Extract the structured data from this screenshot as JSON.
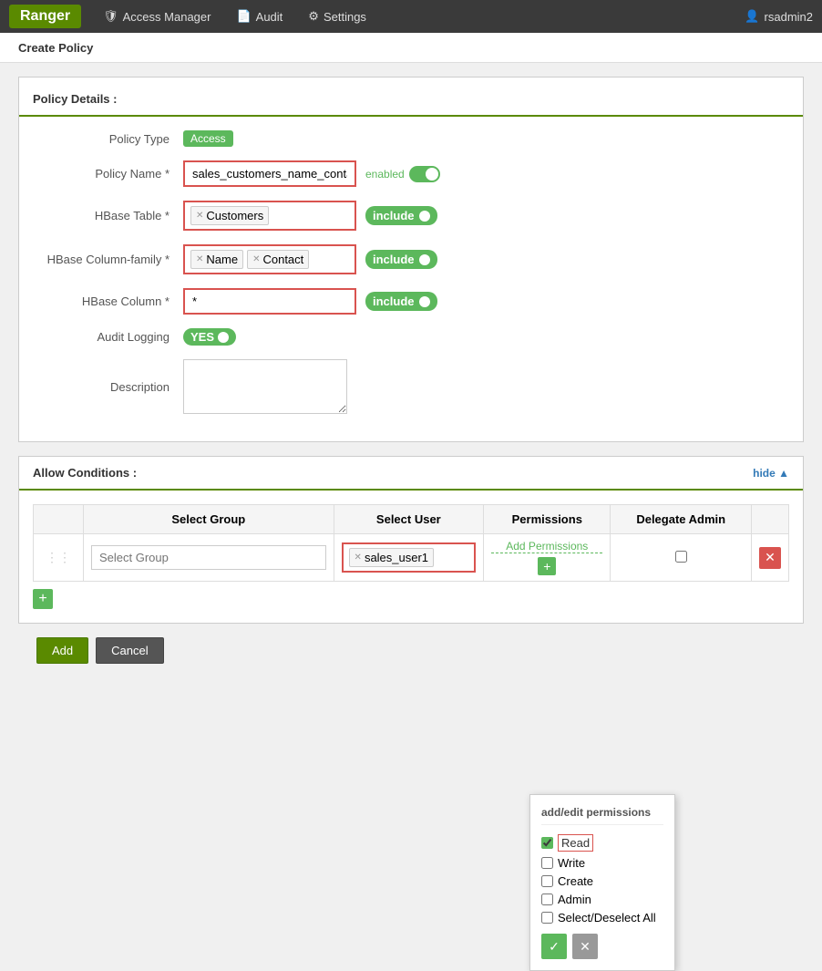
{
  "nav": {
    "brand": "Ranger",
    "items": [
      {
        "id": "access-manager",
        "label": "Access Manager",
        "icon": "🛡"
      },
      {
        "id": "audit",
        "label": "Audit",
        "icon": "📄"
      },
      {
        "id": "settings",
        "label": "Settings",
        "icon": "⚙"
      }
    ],
    "user": "rsadmin2",
    "user_icon": "👤"
  },
  "page": {
    "title": "Create Policy"
  },
  "policy_details": {
    "section_title": "Policy Details :",
    "policy_type_label": "Policy Type",
    "policy_type_badge": "Access",
    "policy_name_label": "Policy Name *",
    "policy_name_value": "sales_customers_name_contact",
    "policy_name_enabled": "enabled",
    "hbase_table_label": "HBase Table *",
    "hbase_table_tag": "Customers",
    "hbase_table_include": "include",
    "hbase_column_family_label": "HBase Column-family *",
    "hbase_column_tag1": "Name",
    "hbase_column_tag2": "Contact",
    "hbase_column_include": "include",
    "hbase_column_label": "HBase Column *",
    "hbase_column_value": "*",
    "hbase_column_include2": "include",
    "audit_logging_label": "Audit Logging",
    "audit_yes": "YES",
    "description_label": "Description"
  },
  "allow_conditions": {
    "section_title": "Allow Conditions :",
    "hide_label": "hide ▲",
    "table_headers": {
      "select_group": "Select Group",
      "select_user": "Select User",
      "permissions": "Permissions",
      "delegate_admin": "Delegate Admin"
    },
    "row": {
      "group_placeholder": "Select Group",
      "user_tag": "sales_user1",
      "add_perms_label": "Add Permissions",
      "add_perms_btn": "+"
    }
  },
  "permissions_popup": {
    "title": "add/edit permissions",
    "checkboxes": [
      {
        "id": "read",
        "label": "Read",
        "checked": true
      },
      {
        "id": "write",
        "label": "Write",
        "checked": false
      },
      {
        "id": "create",
        "label": "Create",
        "checked": false
      },
      {
        "id": "admin",
        "label": "Admin",
        "checked": false
      },
      {
        "id": "select_deselect",
        "label": "Select/Deselect All",
        "checked": false
      }
    ],
    "ok_icon": "✓",
    "cancel_icon": "✕"
  },
  "bottom_buttons": {
    "add_label": "Add",
    "cancel_label": "Cancel"
  }
}
